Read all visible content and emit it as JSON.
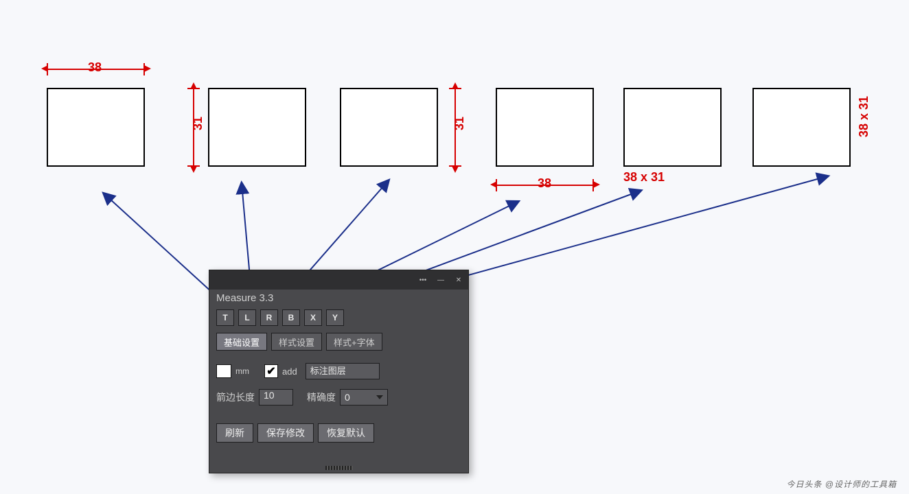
{
  "dims": {
    "top_width": "38",
    "left_height_2": "31",
    "left_height_3": "31",
    "bottom_width_4": "38",
    "below_5": "38 x 31",
    "right_6": "38 x 31"
  },
  "panel": {
    "title": "Measure 3.3",
    "top_buttons": [
      "T",
      "L",
      "R",
      "B",
      "X",
      "Y"
    ],
    "tabs": {
      "basic": "基础设置",
      "style": "样式设置",
      "style_font": "样式+字体"
    },
    "unit_label": "mm",
    "add_checkbox_label": "add",
    "layer_field": "标注图层",
    "arrow_len_label": "箭边长度",
    "arrow_len_value": "10",
    "precision_label": "精确度",
    "precision_value": "0",
    "buttons": {
      "refresh": "刷新",
      "save": "保存修改",
      "reset": "恢复默认"
    }
  },
  "footer": "今日头条 @设计师的工具箱"
}
